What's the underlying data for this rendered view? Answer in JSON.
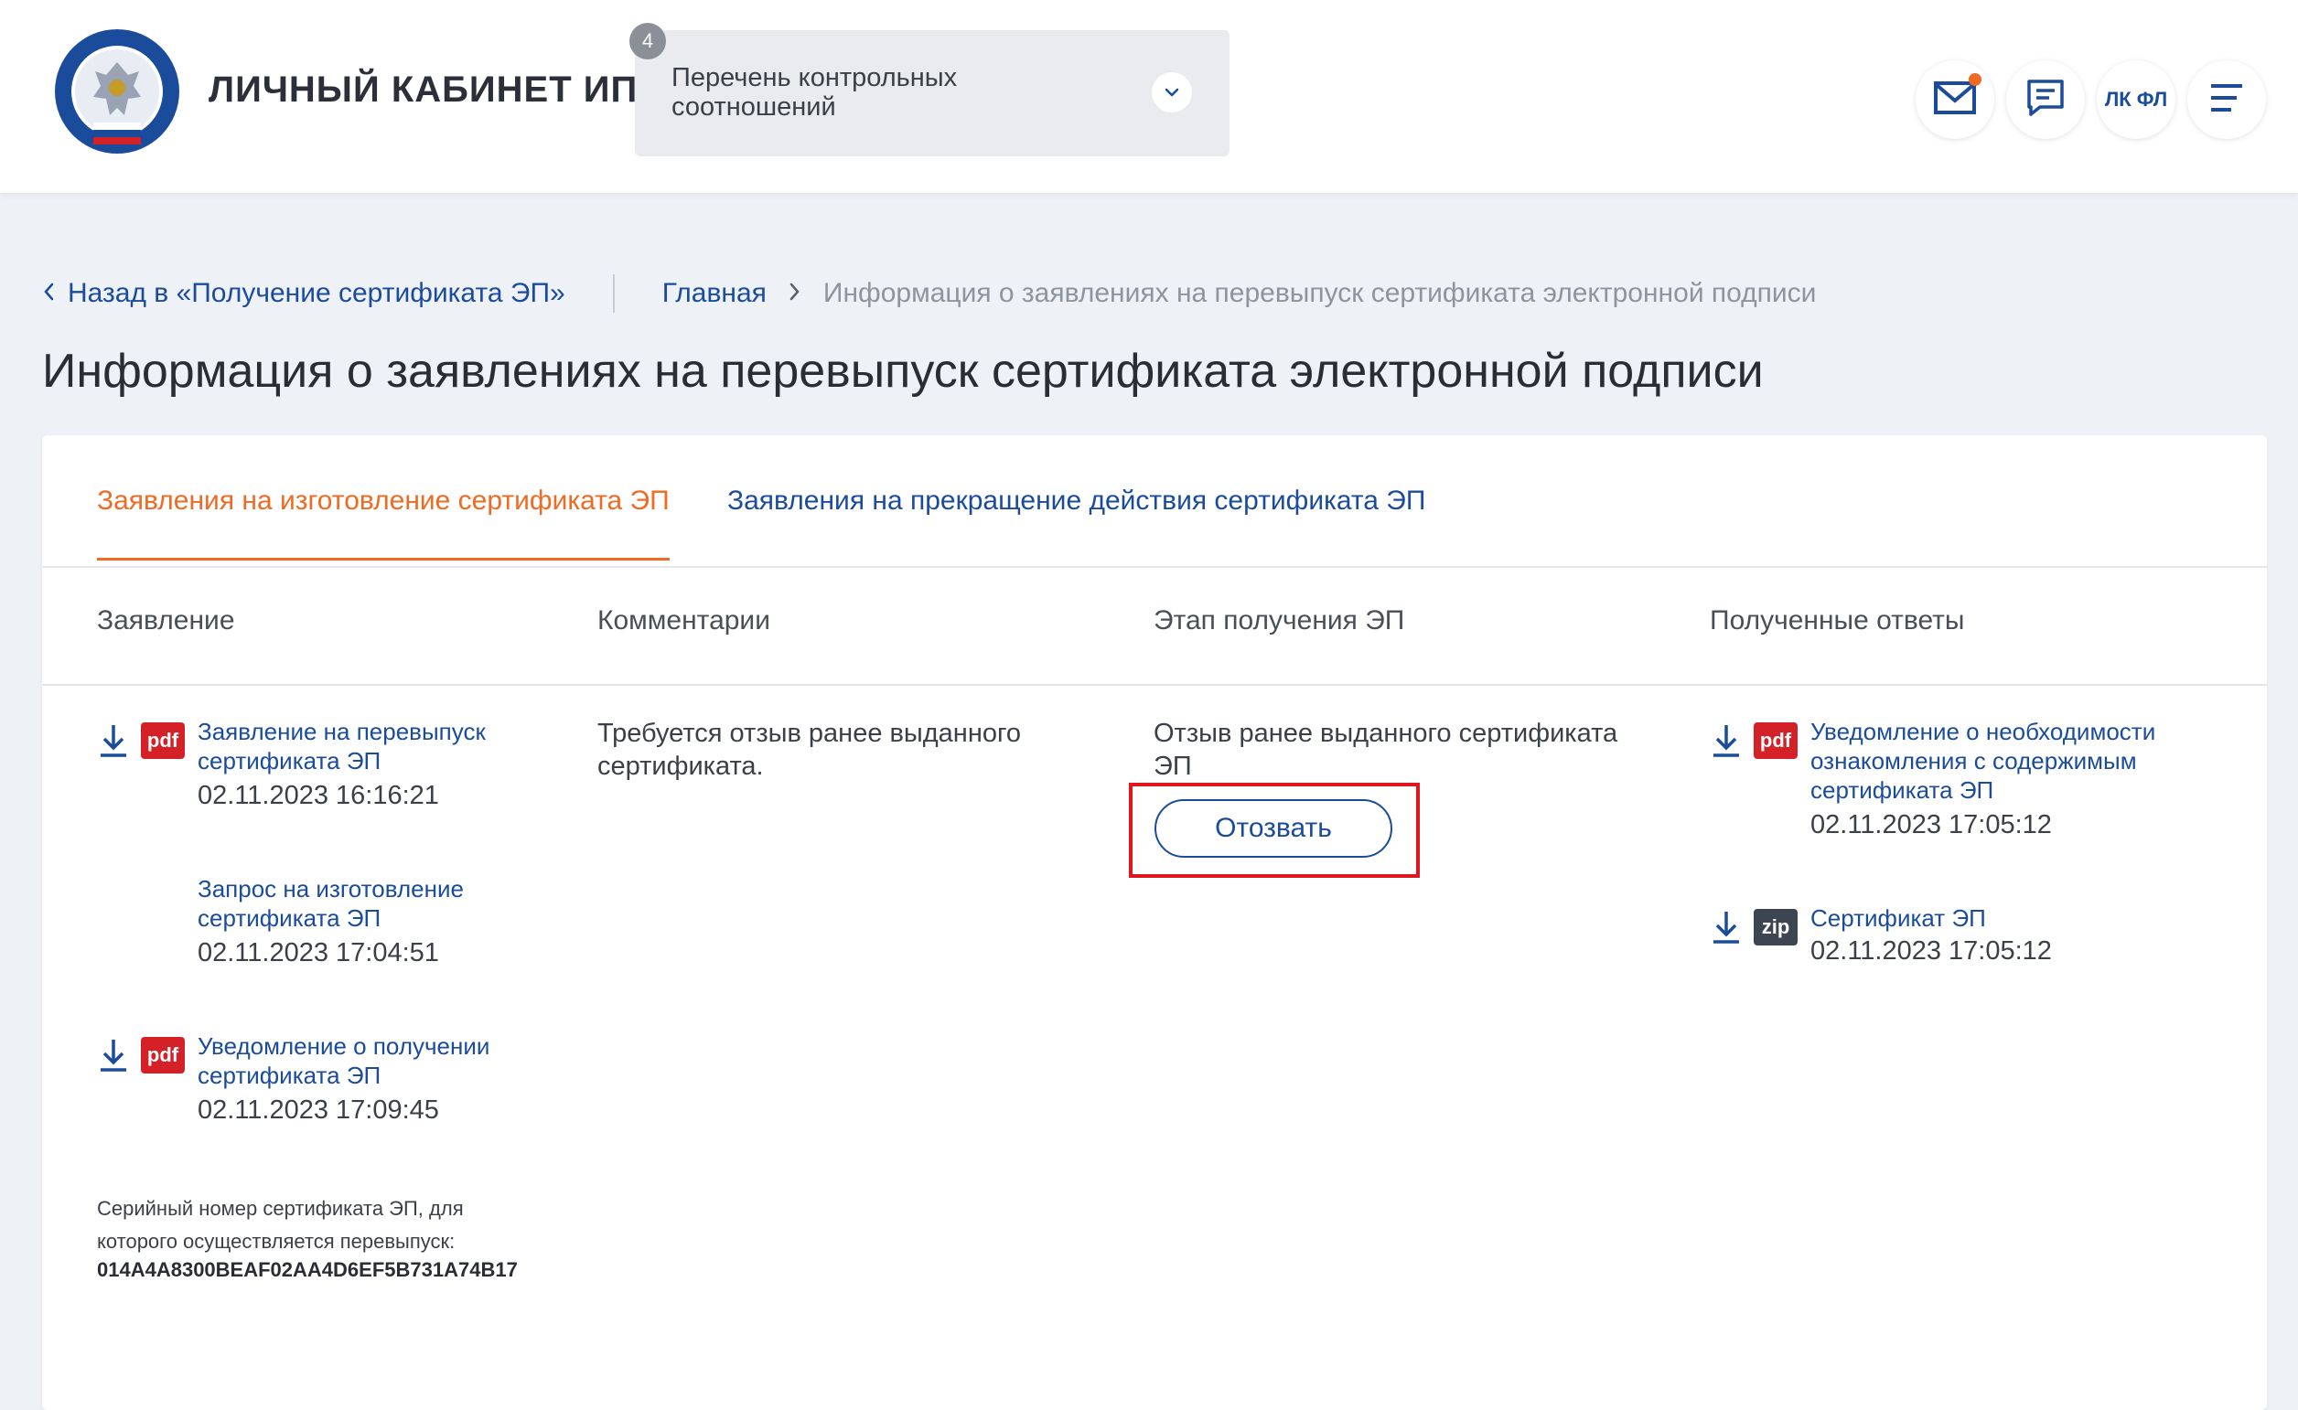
{
  "header": {
    "brand": "ЛИЧНЫЙ КАБИНЕТ ИП",
    "dropdown": {
      "badge": "4",
      "text": "Перечень контрольных соотношений"
    },
    "lk_fl": "ЛК ФЛ"
  },
  "breadcrumb": {
    "back": "Назад в «Получение сертификата ЭП»",
    "home": "Главная",
    "current": "Информация о заявлениях на перевыпуск сертификата электронной подписи"
  },
  "page_title": "Информация о заявлениях на перевыпуск сертификата электронной подписи",
  "tabs": [
    {
      "label": "Заявления на изготовление сертификата ЭП"
    },
    {
      "label": "Заявления на прекращение действия сертификата ЭП"
    }
  ],
  "columns": [
    "Заявление",
    "Комментарии",
    "Этап получения ЭП",
    "Полученные ответы"
  ],
  "applications": [
    {
      "file_type": "pdf",
      "title": "Заявление на перевыпуск сертификата ЭП",
      "date": "02.11.2023 16:16:21"
    },
    {
      "file_type": "",
      "title": "Запрос на изготовление сертификата ЭП",
      "date": "02.11.2023 17:04:51"
    },
    {
      "file_type": "pdf",
      "title": "Уведомление о получении сертификата ЭП",
      "date": "02.11.2023 17:09:45"
    }
  ],
  "serial": {
    "label": "Серийный номер сертификата ЭП, для которого осуществляется перевыпуск:",
    "value": "014A4A8300BEAF02AA4D6EF5B731A74B17"
  },
  "comment": "Требуется отзыв ранее выданного сертификата.",
  "stage": {
    "text": "Отзыв ранее выданного сертификата ЭП",
    "button": "Отозвать"
  },
  "responses": [
    {
      "file_type": "pdf",
      "title": "Уведомление о необходимости ознакомления с содержимым сертификата ЭП",
      "date": "02.11.2023 17:05:12"
    },
    {
      "file_type": "zip",
      "title": "Сертификат ЭП",
      "date": "02.11.2023 17:05:12"
    }
  ],
  "colors": {
    "accent_orange": "#ef6a22",
    "link_blue": "#1b4c9c",
    "pdf_red": "#d42128",
    "zip_dark": "#3d4553",
    "highlight_red": "#e0161e"
  }
}
